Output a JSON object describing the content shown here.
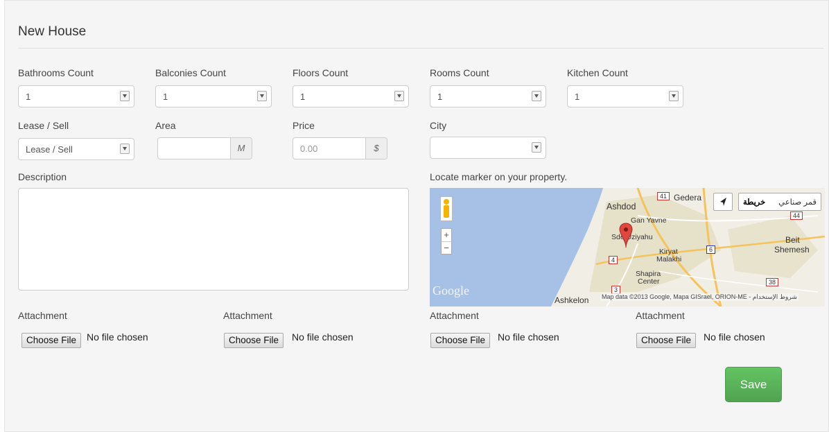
{
  "form": {
    "title": "New House",
    "fields": {
      "bathrooms": {
        "label": "Bathrooms Count",
        "value": "1"
      },
      "balconies": {
        "label": "Balconies Count",
        "value": "1"
      },
      "floors": {
        "label": "Floors Count",
        "value": "1"
      },
      "rooms": {
        "label": "Rooms Count",
        "value": "1"
      },
      "kitchen": {
        "label": "Kitchen Count",
        "value": "1"
      },
      "lease": {
        "label": "Lease / Sell",
        "value": "Lease / Sell"
      },
      "area": {
        "label": "Area",
        "value": "",
        "addon": "M"
      },
      "price": {
        "label": "Price",
        "placeholder": "0.00",
        "addon": "$"
      },
      "city": {
        "label": "City",
        "value": ""
      },
      "description": {
        "label": "Description",
        "value": ""
      }
    },
    "map": {
      "label": "Locate marker on your property.",
      "map_type_map": "خريطة",
      "map_type_satellite": "قمر صناعي",
      "zoom_in": "+",
      "zoom_out": "−",
      "places": [
        "Gedera",
        "Ashdod",
        "Gan Yavne",
        "Sde Uziyahu",
        "Beit",
        "Shemesh",
        "Kiryat",
        "Malakhi",
        "Shapira",
        "Center",
        "Ashkelon"
      ],
      "roads": [
        "41",
        "44",
        "4",
        "6",
        "3",
        "38"
      ],
      "google_logo": "Google",
      "attribution": "Map data ©2013 Google, Mapa GISrael, ORION-ME - شروط الإستخدام"
    },
    "attachments": [
      {
        "label": "Attachment",
        "button": "Choose File",
        "status": "No file chosen"
      },
      {
        "label": "Attachment",
        "button": "Choose File",
        "status": "No file chosen"
      },
      {
        "label": "Attachment",
        "button": "Choose File",
        "status": "No file chosen"
      },
      {
        "label": "Attachment",
        "button": "Choose File",
        "status": "No file chosen"
      }
    ],
    "save_label": "Save"
  },
  "colors": {
    "save_button": "#5bb75b",
    "map_water": "#a7c0e6",
    "map_land": "#f2efe6"
  }
}
